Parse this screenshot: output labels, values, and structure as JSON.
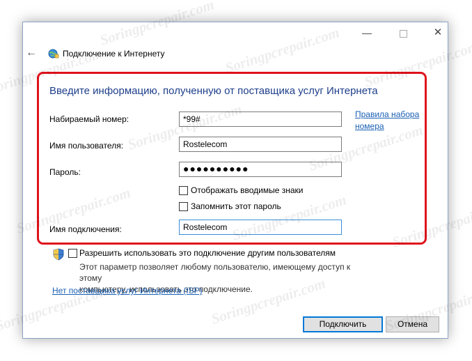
{
  "window": {
    "title": "Подключение к Интернету"
  },
  "form": {
    "heading": "Введите информацию, полученную от поставщика услуг Интернета",
    "dial_label": "Набираемый номер:",
    "dial_value": "*99#",
    "dial_rules_link": "Правила набора номера",
    "dial_rules_line1": "Правила набора",
    "dial_rules_line2": "номера",
    "username_label": "Имя пользователя:",
    "username_value": "Rostelecom",
    "password_label": "Пароль:",
    "password_value": "●●●●●●●●●●",
    "show_chars_label": "Отображать вводимые знаки",
    "show_chars_checked": false,
    "remember_label": "Запомнить этот пароль",
    "remember_checked": false,
    "connection_name_label": "Имя подключения:",
    "connection_name_value": "Rostelecom"
  },
  "sharing": {
    "allow_label": "Разрешить использовать это подключение другим пользователям",
    "allow_checked": false,
    "description_line1": "Этот параметр позволяет любому пользователю, имеющему доступ к этому",
    "description_line2": "компьютеру, использовать это подключение."
  },
  "no_isp_link": "Нет поставщика услуг Интернета (ISP)",
  "buttons": {
    "connect": "Подключить",
    "cancel": "Отмена"
  },
  "watermark": "Soringpcrepair.com",
  "colors": {
    "heading": "#1e3f8a",
    "link": "#1a5fb4",
    "highlight_box": "#e0121b",
    "focus_border": "#3b8ed8"
  },
  "icons": {
    "back": "back-arrow-icon",
    "network": "globe-network-icon",
    "shield": "uac-shield-icon",
    "minimize": "minimize-icon",
    "maximize": "maximize-icon",
    "close": "close-icon"
  }
}
